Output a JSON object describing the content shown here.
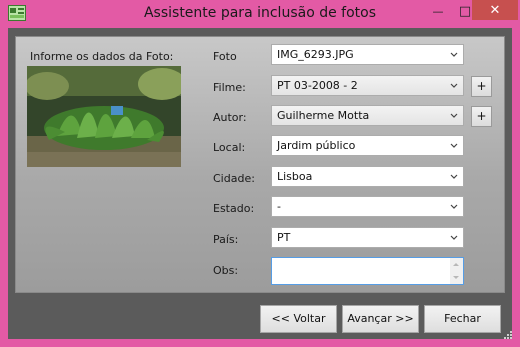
{
  "window": {
    "title": "Assistente para inclusão de fotos",
    "minimize": "—",
    "maximize": "□",
    "close": "✕"
  },
  "photo_section": {
    "label": "Informe os dados da Foto:"
  },
  "form": {
    "foto": {
      "label": "Foto",
      "value": "IMG_6293.JPG"
    },
    "filme": {
      "label": "Filme:",
      "value": "PT 03-2008 - 2",
      "add": "+"
    },
    "autor": {
      "label": "Autor:",
      "value": "Guilherme Motta",
      "add": "+"
    },
    "local": {
      "label": "Local:",
      "value": "Jardim público"
    },
    "cidade": {
      "label": "Cidade:",
      "value": "Lisboa"
    },
    "estado": {
      "label": "Estado:",
      "value": "-"
    },
    "pais": {
      "label": "País:",
      "value": "PT"
    },
    "obs": {
      "label": "Obs:",
      "value": ""
    }
  },
  "buttons": {
    "back": "<< Voltar",
    "next": "Avançar >>",
    "close": "Fechar"
  },
  "icons": [
    "app-icon",
    "minimize-icon",
    "maximize-icon",
    "close-icon",
    "chevron-down-icon",
    "resize-grip-icon"
  ],
  "colors": {
    "window_frame": "#e35aa5",
    "client_background": "#5b5b5b",
    "close_button": "#c7504f",
    "focus_border": "#569de5"
  }
}
